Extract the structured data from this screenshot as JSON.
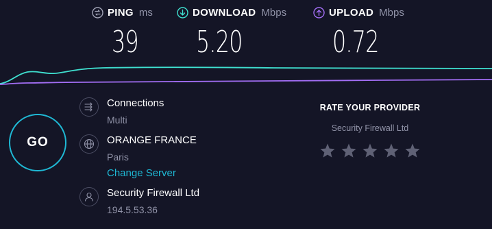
{
  "metrics": {
    "ping": {
      "label": "PING",
      "unit": "ms",
      "value": "39",
      "icon": "ping-icon",
      "color": "#a1a3b6"
    },
    "download": {
      "label": "DOWNLOAD",
      "unit": "Mbps",
      "value": "5.20",
      "icon": "download-arrow-icon",
      "color": "#3fe0d0"
    },
    "upload": {
      "label": "UPLOAD",
      "unit": "Mbps",
      "value": "0.72",
      "icon": "upload-arrow-icon",
      "color": "#a36ef5"
    }
  },
  "go_button": {
    "label": "GO",
    "color": "#1fb8d4"
  },
  "connections": {
    "title": "Connections",
    "value": "Multi",
    "icon": "connections-arrows-icon"
  },
  "server": {
    "title": "ORANGE FRANCE",
    "location": "Paris",
    "change_link": "Change Server",
    "icon": "globe-icon"
  },
  "provider": {
    "title": "Security Firewall Ltd",
    "ip": "194.5.53.36",
    "icon": "user-icon"
  },
  "rating": {
    "title": "RATE YOUR PROVIDER",
    "provider": "Security Firewall Ltd",
    "stars_total": 5,
    "stars_filled": 0,
    "star_color": "#5f6175"
  },
  "colors": {
    "background": "#141526",
    "accent": "#1fb8d4",
    "muted_text": "#9193a8"
  }
}
